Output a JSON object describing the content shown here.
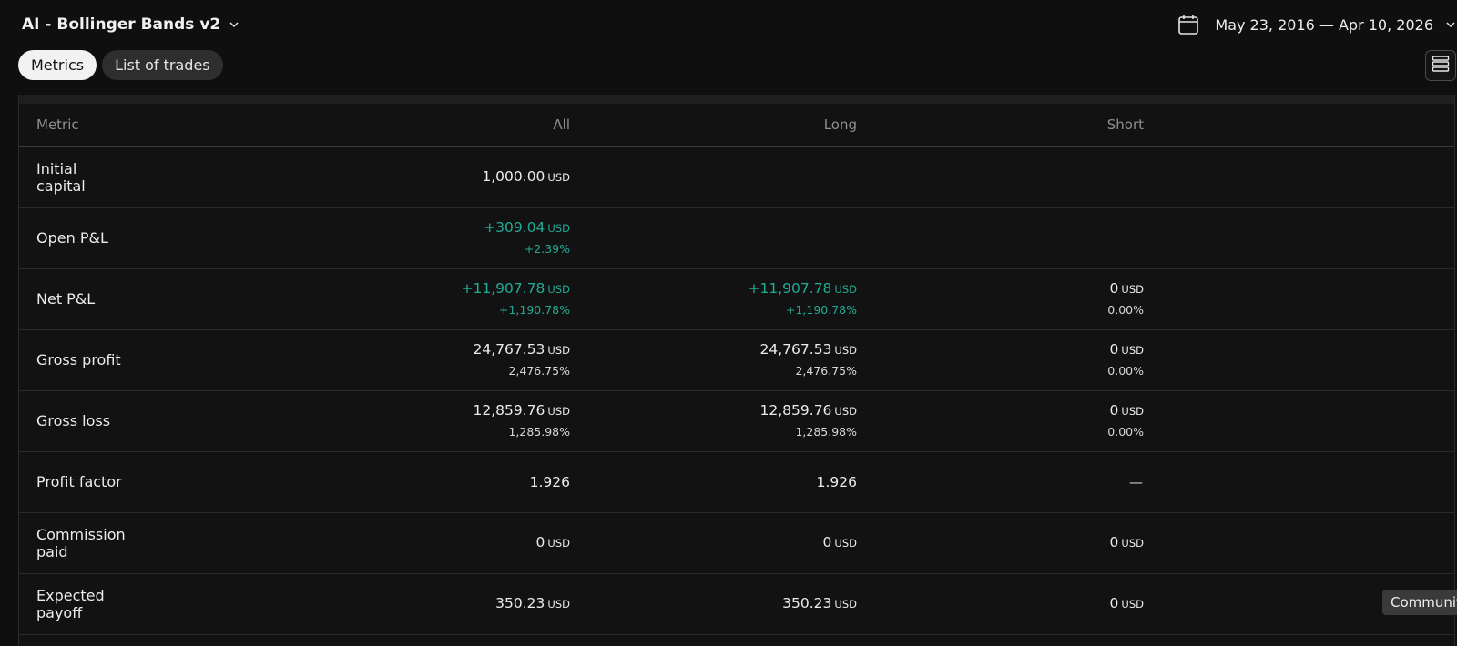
{
  "header": {
    "strategy_title": "AI - Bollinger Bands v2",
    "date_range": "May 23, 2016 — Apr 10, 2026"
  },
  "tabs": [
    {
      "label": "Metrics",
      "active": true
    },
    {
      "label": "List of trades",
      "active": false
    }
  ],
  "table": {
    "headers": [
      "Metric",
      "All",
      "Long",
      "Short"
    ],
    "rows": [
      {
        "metric": "Initial capital",
        "all": {
          "value": "1,000.00",
          "unit": "USD"
        },
        "long": {
          "value": "",
          "unit": ""
        },
        "short": {
          "value": "",
          "unit": ""
        }
      },
      {
        "metric": "Open P&L",
        "all": {
          "value": "+309.04",
          "unit": "USD",
          "sub": "+2.39%"
        },
        "long": {
          "value": "",
          "unit": ""
        },
        "short": {
          "value": "",
          "unit": ""
        }
      },
      {
        "metric": "Net P&L",
        "all": {
          "value": "+11,907.78",
          "unit": "USD",
          "sub": "+1,190.78%"
        },
        "long": {
          "value": "+11,907.78",
          "unit": "USD",
          "sub": "+1,190.78%"
        },
        "short": {
          "value": "0",
          "unit": "USD",
          "sub": "0.00%"
        }
      },
      {
        "metric": "Gross profit",
        "all": {
          "value": "24,767.53",
          "unit": "USD",
          "sub": "2,476.75%"
        },
        "long": {
          "value": "24,767.53",
          "unit": "USD",
          "sub": "2,476.75%"
        },
        "short": {
          "value": "0",
          "unit": "USD",
          "sub": "0.00%"
        }
      },
      {
        "metric": "Gross loss",
        "all": {
          "value": "12,859.76",
          "unit": "USD",
          "sub": "1,285.98%"
        },
        "long": {
          "value": "12,859.76",
          "unit": "USD",
          "sub": "1,285.98%"
        },
        "short": {
          "value": "0",
          "unit": "USD",
          "sub": "0.00%"
        }
      },
      {
        "metric": "Profit factor",
        "all": {
          "value": "1.926"
        },
        "long": {
          "value": "1.926"
        },
        "short": {
          "value": "—"
        }
      },
      {
        "metric": "Commission paid",
        "all": {
          "value": "0",
          "unit": "USD"
        },
        "long": {
          "value": "0",
          "unit": "USD"
        },
        "short": {
          "value": "0",
          "unit": "USD"
        }
      },
      {
        "metric": "Expected payoff",
        "all": {
          "value": "350.23",
          "unit": "USD"
        },
        "long": {
          "value": "350.23",
          "unit": "USD"
        },
        "short": {
          "value": "0",
          "unit": "USD"
        }
      }
    ]
  },
  "tooltip": {
    "label": "Community"
  },
  "icons": {
    "title_dropdown": "chevron-down-icon",
    "calendar": "calendar-icon",
    "date_dropdown": "chevron-down-icon",
    "layout_toggle": "list-layout-icon"
  },
  "colors": {
    "background": "#0f0f0f",
    "positive": "#22ab94",
    "tab_active_bg": "#f2f2f2",
    "tab_inactive_bg": "#2e2e2e"
  }
}
